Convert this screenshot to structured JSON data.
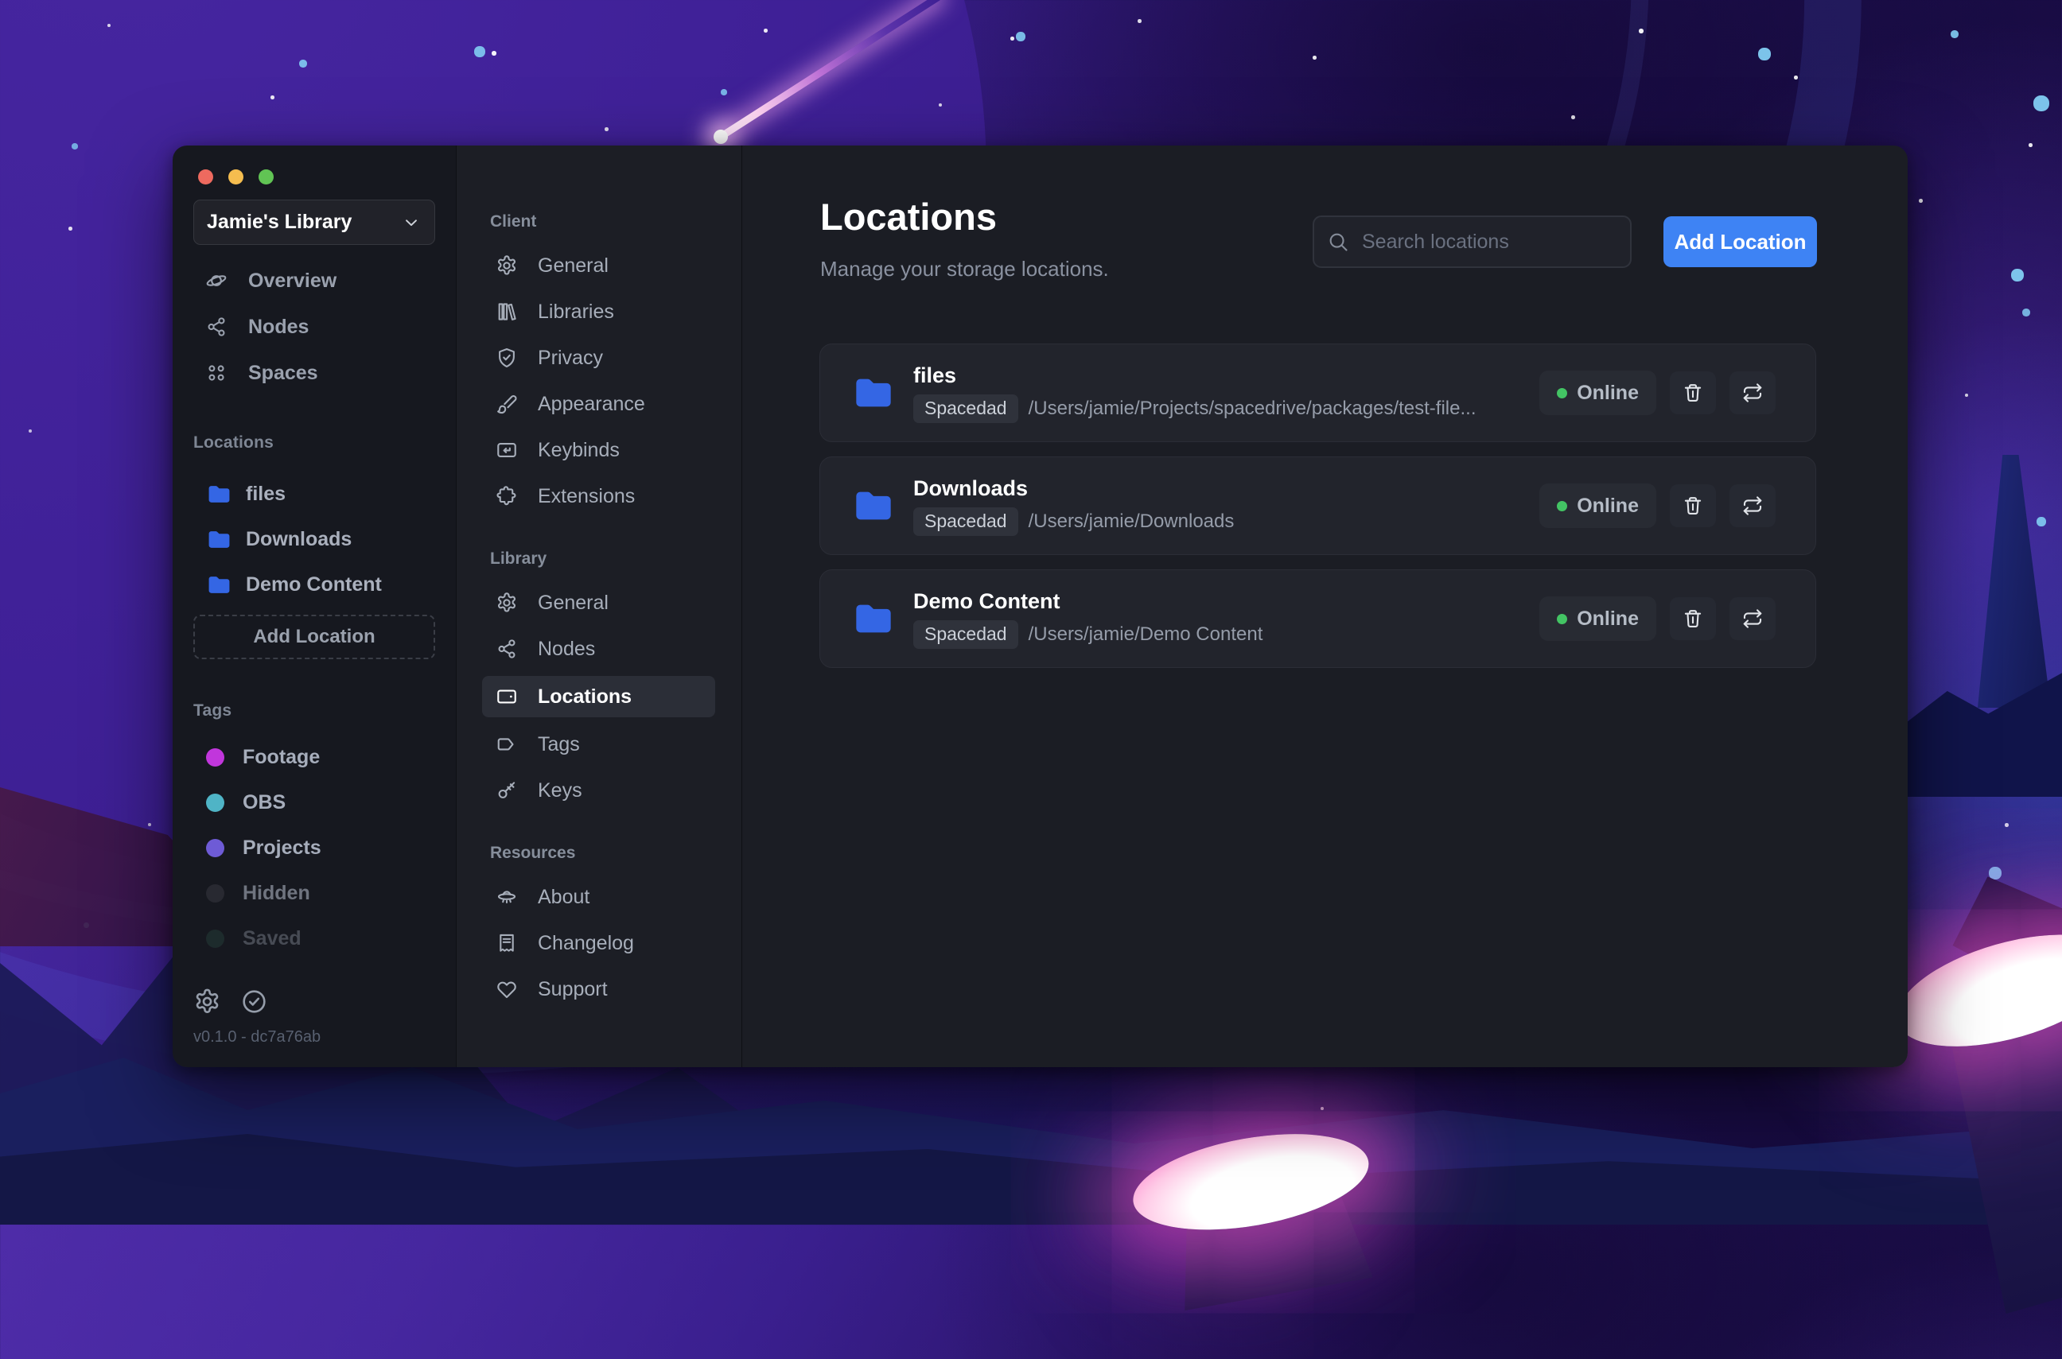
{
  "colors": {
    "accent_blue": "#3e83f4",
    "online_green": "#43c464",
    "traffic_close": "#ee6a5f",
    "traffic_minimize": "#f5bd4f",
    "traffic_zoom": "#61c454"
  },
  "window": {
    "library_switcher": {
      "label": "Jamie's Library"
    },
    "sidebar": {
      "nav": [
        {
          "label": "Overview"
        },
        {
          "label": "Nodes"
        },
        {
          "label": "Spaces"
        }
      ],
      "locations": {
        "title": "Locations",
        "items": [
          {
            "label": "files"
          },
          {
            "label": "Downloads"
          },
          {
            "label": "Demo Content"
          }
        ],
        "add_label": "Add Location"
      },
      "tags": {
        "title": "Tags",
        "items": [
          {
            "label": "Footage",
            "color": "#c136dc"
          },
          {
            "label": "OBS",
            "color": "#4fb4c6"
          },
          {
            "label": "Projects",
            "color": "#6e5bd6"
          },
          {
            "label": "Hidden",
            "color": "#33343c"
          },
          {
            "label": "Saved",
            "color": "#2d5046"
          }
        ]
      },
      "footer": {
        "version": "v0.1.0 - dc7a76ab"
      }
    },
    "settings_nav": {
      "sections": [
        {
          "title": "Client",
          "items": [
            {
              "label": "General"
            },
            {
              "label": "Libraries"
            },
            {
              "label": "Privacy"
            },
            {
              "label": "Appearance"
            },
            {
              "label": "Keybinds"
            },
            {
              "label": "Extensions"
            }
          ]
        },
        {
          "title": "Library",
          "items": [
            {
              "label": "General"
            },
            {
              "label": "Nodes"
            },
            {
              "label": "Locations",
              "selected": true
            },
            {
              "label": "Tags"
            },
            {
              "label": "Keys"
            }
          ]
        },
        {
          "title": "Resources",
          "items": [
            {
              "label": "About"
            },
            {
              "label": "Changelog"
            },
            {
              "label": "Support"
            }
          ]
        }
      ]
    },
    "main": {
      "title": "Locations",
      "subtitle": "Manage your storage locations.",
      "search_placeholder": "Search locations",
      "add_button": "Add Location",
      "locations": [
        {
          "name": "files",
          "node": "Spacedad",
          "path": "/Users/jamie/Projects/spacedrive/packages/test-file...",
          "status": "Online"
        },
        {
          "name": "Downloads",
          "node": "Spacedad",
          "path": "/Users/jamie/Downloads",
          "status": "Online"
        },
        {
          "name": "Demo Content",
          "node": "Spacedad",
          "path": "/Users/jamie/Demo Content",
          "status": "Online"
        }
      ]
    }
  }
}
